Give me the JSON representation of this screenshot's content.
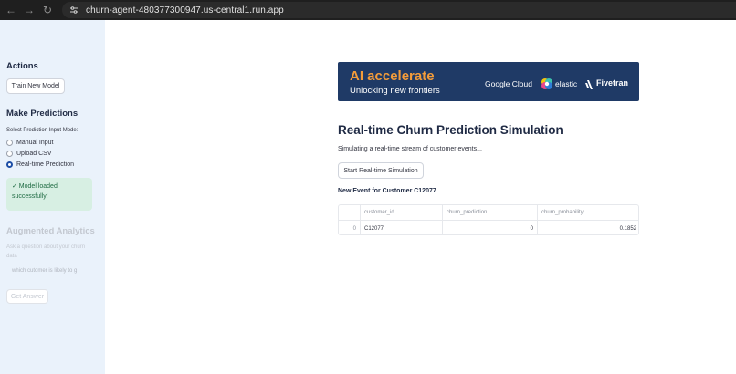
{
  "browser": {
    "url": "churn-agent-480377300947.us-central1.run.app"
  },
  "sidebar": {
    "actions_title": "Actions",
    "train_button": "Train New Model",
    "predictions_title": "Make Predictions",
    "mode_label": "Select Prediction Input Mode:",
    "modes": [
      {
        "label": "Manual Input",
        "selected": false
      },
      {
        "label": "Upload CSV",
        "selected": false
      },
      {
        "label": "Real-time Prediction",
        "selected": true
      }
    ],
    "alert_line1": "✓ Model loaded",
    "alert_line2": "successfully!",
    "analytics_title": "Augmented Analytics",
    "question_line1": "Ask a question about your churn",
    "question_line2": "data",
    "question_placeholder": "which cutomer is likely to g",
    "answer_button": "Get Answer"
  },
  "banner": {
    "title": "AI accelerate",
    "subtitle": "Unlocking new frontiers",
    "google_cloud": "Google Cloud",
    "elastic": "elastic",
    "fivetran": "Fivetran"
  },
  "main": {
    "title": "Real-time Churn Prediction Simulation",
    "description": "Simulating a real-time stream of customer events...",
    "start_button": "Start Real-time Simulation",
    "event_heading": "New Event for Customer C12077"
  },
  "table": {
    "columns": [
      "customer_id",
      "churn_prediction",
      "churn_probability"
    ],
    "rows": [
      {
        "index": "0",
        "customer_id": "C12077",
        "churn_prediction": "0",
        "churn_probability": "0.1852"
      }
    ]
  },
  "colors": {
    "sidebar_bg": "#eaf2fb",
    "banner_bg": "#1f3a66",
    "banner_title": "#f39c3a",
    "success_bg": "#d7efe3"
  }
}
